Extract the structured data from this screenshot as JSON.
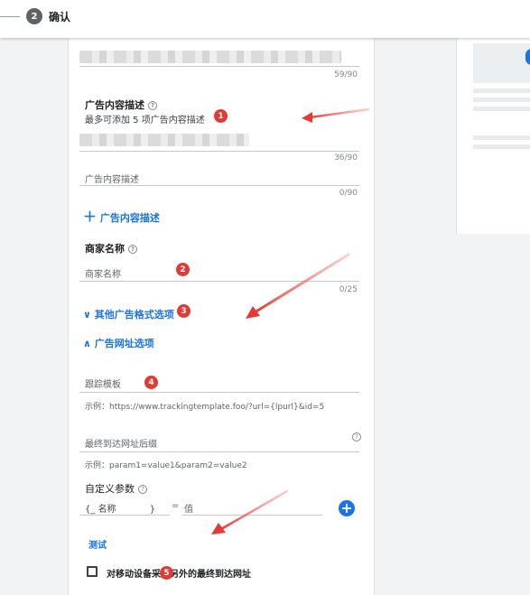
{
  "header": {
    "step_number": "2",
    "step_label": "确认"
  },
  "form": {
    "headline_counter": "59/90",
    "description_section": {
      "title": "广告内容描述",
      "subtitle": "最多可添加 5 项广告内容描述",
      "desc1_counter": "36/90",
      "desc2_placeholder": "广告内容描述",
      "desc2_counter": "0/90",
      "add_label": "广告内容描述"
    },
    "business_name": {
      "title": "商家名称",
      "placeholder": "商家名称",
      "counter": "0/25"
    },
    "other_formats_label": "其他广告格式选项",
    "url_options_label": "广告网址选项",
    "tracking_template": {
      "label": "跟踪模板",
      "example": "示例：https://www.trackingtemplate.foo/?url={lpurl}&id=5"
    },
    "final_url_suffix": {
      "label": "最终到达网址后缀",
      "example": "示例：param1=value1&param2=value2"
    },
    "custom_params": {
      "title": "自定义参数",
      "name_placeholder": "名称",
      "equals": "=",
      "value_placeholder": "值"
    },
    "test_label": "测试",
    "mobile_checkbox_label": "对移动设备采用另外的最终到达网址"
  },
  "annotations": {
    "badge_1": "1",
    "badge_2": "2",
    "badge_3": "3",
    "badge_4": "4",
    "badge_5": "5"
  },
  "colors": {
    "accent_blue": "#1a73e8",
    "annotation_red": "#e53935"
  }
}
